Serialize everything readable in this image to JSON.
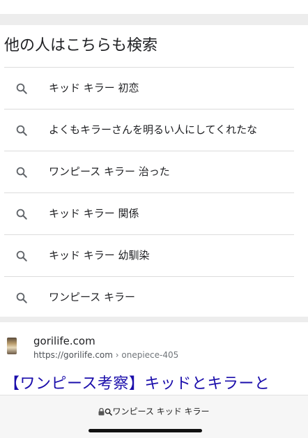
{
  "related": {
    "title": "他の人はこちらも検索",
    "items": [
      {
        "label": "キッド キラー 初恋"
      },
      {
        "label": "よくもキラーさんを明るい人にしてくれたな"
      },
      {
        "label": "ワンピース キラー 治った"
      },
      {
        "label": "キッド キラー 関係"
      },
      {
        "label": "キッド キラー 幼馴染"
      },
      {
        "label": "ワンピース キラー"
      }
    ]
  },
  "result": {
    "site_name": "gorilife.com",
    "url": "https://gorilife.com",
    "url_path": " › onepiece-405",
    "title": "【ワンピース考察】キッドとキラーと"
  },
  "address_bar": {
    "text": "ワンピース キッド キラー"
  }
}
